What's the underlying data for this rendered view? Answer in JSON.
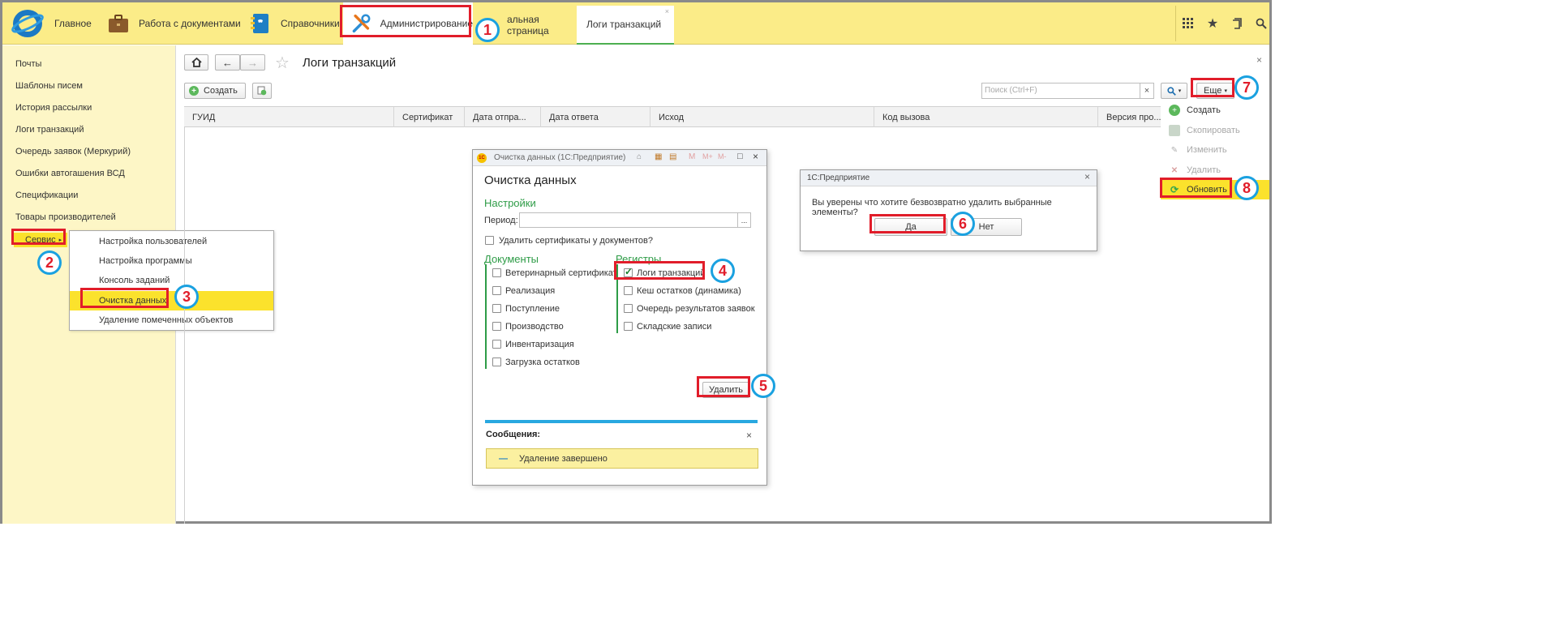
{
  "topbar": {
    "nav": [
      {
        "label": "Главное"
      },
      {
        "label": "Работа с документами"
      },
      {
        "label": "Справочники"
      },
      {
        "label": "Администрирование"
      }
    ],
    "tabs": [
      {
        "label": "альная страница"
      },
      {
        "label": "Логи транзакций"
      }
    ]
  },
  "sidebar": {
    "items": [
      {
        "label": "Почты"
      },
      {
        "label": "Шаблоны писем"
      },
      {
        "label": "История рассылки"
      },
      {
        "label": "Логи транзакций"
      },
      {
        "label": "Очередь заявок (Меркурий)"
      },
      {
        "label": "Ошибки автогашения ВСД"
      },
      {
        "label": "Спецификации"
      },
      {
        "label": "Товары производителей"
      },
      {
        "label": "Сервис"
      }
    ]
  },
  "service_menu": {
    "items": [
      {
        "label": "Настройка пользователей"
      },
      {
        "label": "Настройка программы"
      },
      {
        "label": "Консоль заданий"
      },
      {
        "label": "Очистка данных"
      },
      {
        "label": "Удаление помеченных объектов"
      }
    ]
  },
  "form": {
    "title": "Логи транзакций",
    "create_label": "Создать",
    "search_placeholder": "Поиск (Ctrl+F)",
    "more_label": "Еще",
    "columns": [
      "ГУИД",
      "Сертификат",
      "Дата отпра...",
      "Дата ответа",
      "Исход",
      "Код вызова",
      "Версия про..."
    ]
  },
  "more_menu": {
    "items": [
      {
        "label": "Создать",
        "color": "#5cb85c"
      },
      {
        "label": "Скопировать",
        "color": "#b8c9b8"
      },
      {
        "label": "Изменить",
        "color": "#c0c0c0"
      },
      {
        "label": "Удалить",
        "color": "#d9a0a0"
      },
      {
        "label": "Обновить",
        "color": "#3aa64c"
      }
    ]
  },
  "cleanup_dialog": {
    "window_title": "Очистка данных (1С:Предприятие)",
    "title": "Очистка данных",
    "settings_header": "Настройки",
    "period_label": "Период:",
    "delete_certs_label": "Удалить сертификаты у документов?",
    "documents_header": "Документы",
    "documents": [
      {
        "label": "Ветеринарный сертификат"
      },
      {
        "label": "Реализация"
      },
      {
        "label": "Поступление"
      },
      {
        "label": "Производство"
      },
      {
        "label": "Инвентаризация"
      },
      {
        "label": "Загрузка остатков"
      }
    ],
    "registers_header": "Регистры",
    "registers": [
      {
        "label": "Логи транзакций",
        "checked": true
      },
      {
        "label": "Кеш остатков (динамика)"
      },
      {
        "label": "Очередь результатов заявок"
      },
      {
        "label": "Складские записи"
      }
    ],
    "delete_button": "Удалить",
    "messages_header": "Сообщения:",
    "message": "Удаление завершено"
  },
  "confirm_dialog": {
    "title": "1С:Предприятие",
    "text": "Вы уверены что хотите безвозвратно удалить выбранные элементы?",
    "yes": "Да",
    "no": "Нет"
  },
  "markers": [
    "1",
    "2",
    "3",
    "4",
    "5",
    "6",
    "7",
    "8"
  ],
  "colors": {
    "topbar": "#fbec88",
    "sidebar": "#fdf6c6",
    "highlight": "#fbe22c",
    "accent_green": "#2e9c47",
    "annotation_red": "#e11d2a",
    "annotation_blue": "#1aa1e0"
  }
}
